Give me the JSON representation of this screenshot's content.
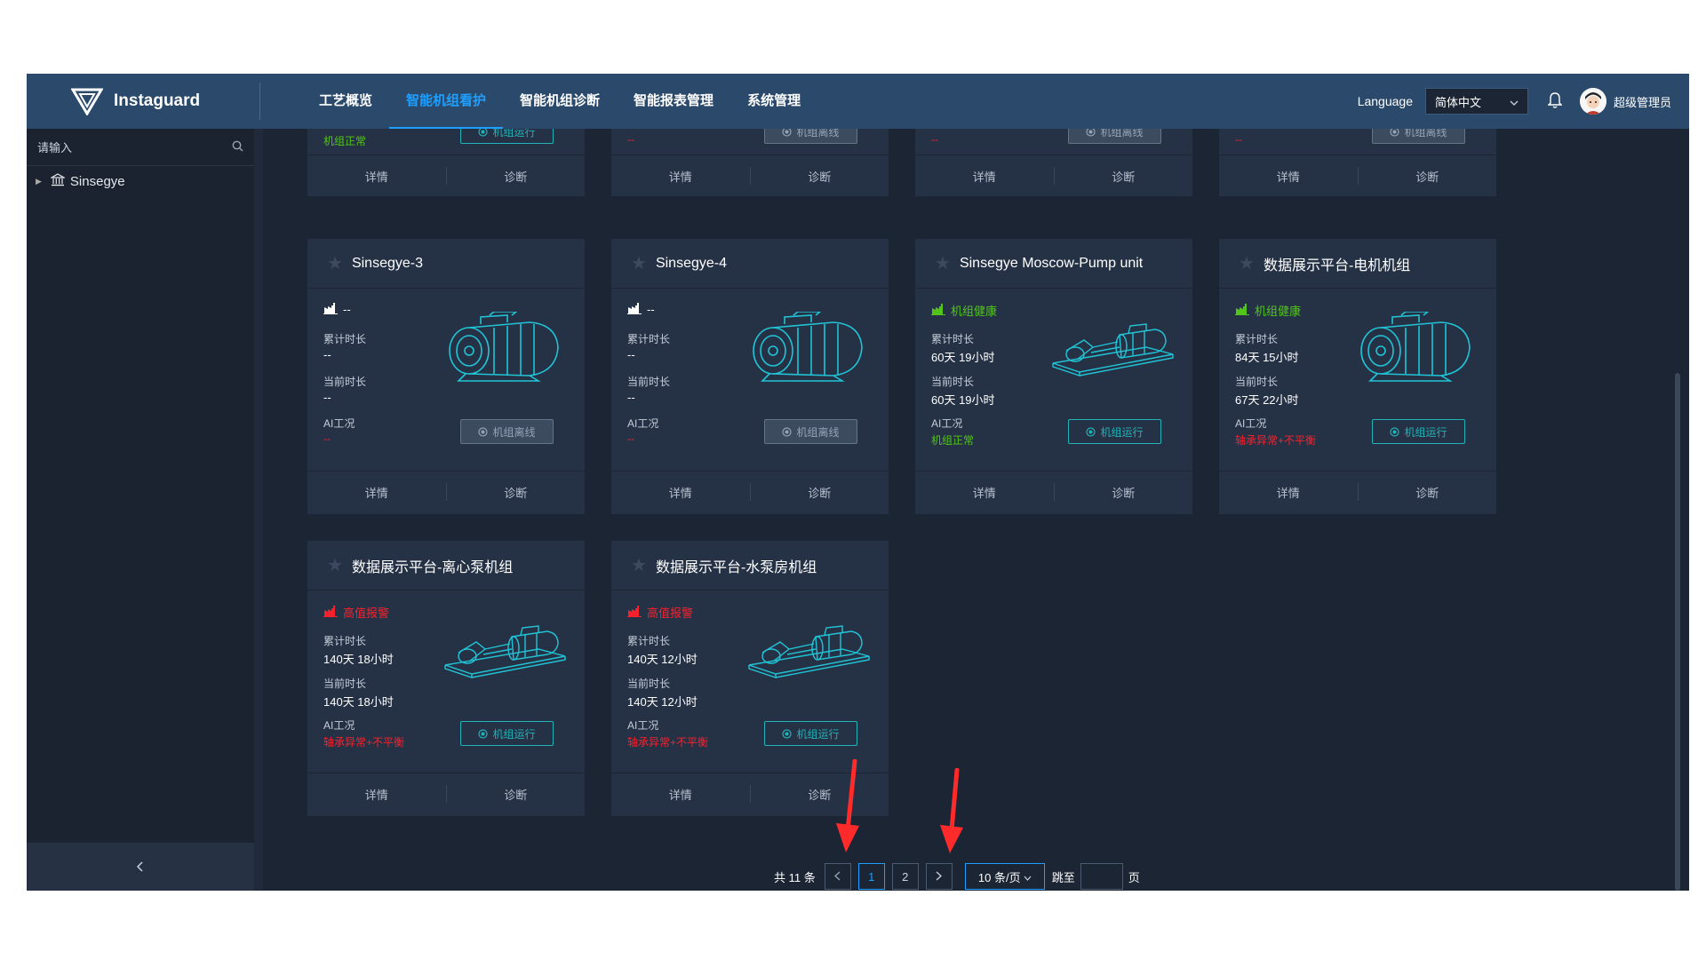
{
  "header": {
    "brand": "Instaguard",
    "nav": [
      {
        "label": "工艺概览",
        "active": false
      },
      {
        "label": "智能机组看护",
        "active": true
      },
      {
        "label": "智能机组诊断",
        "active": false
      },
      {
        "label": "智能报表管理",
        "active": false
      },
      {
        "label": "系统管理",
        "active": false
      }
    ],
    "language_label": "Language",
    "language_value": "简体中文",
    "username": "超级管理员"
  },
  "sidebar": {
    "search_placeholder": "请输入",
    "tree_root": "Sinsegye"
  },
  "labels": {
    "accum": "累计时长",
    "current": "当前时长",
    "ai": "AI工况",
    "detail": "详情",
    "diagnose": "诊断"
  },
  "top_partial_cards": [
    {
      "ai_status": "机组正常",
      "ai_color": "green",
      "button": "机组运行",
      "button_state": "online"
    },
    {
      "ai_status": "--",
      "ai_color": "red",
      "button": "机组离线",
      "button_state": "offline"
    },
    {
      "ai_status": "--",
      "ai_color": "red",
      "button": "机组离线",
      "button_state": "offline"
    },
    {
      "ai_status": "--",
      "ai_color": "red",
      "button": "机组离线",
      "button_state": "offline"
    }
  ],
  "cards": [
    {
      "title": "Sinsegye-3",
      "health": "--",
      "health_color": "white",
      "accum": "--",
      "current": "--",
      "ai_status": "--",
      "ai_color": "red",
      "button": "机组离线",
      "button_state": "offline",
      "machine": "motor"
    },
    {
      "title": "Sinsegye-4",
      "health": "--",
      "health_color": "white",
      "accum": "--",
      "current": "--",
      "ai_status": "--",
      "ai_color": "red",
      "button": "机组离线",
      "button_state": "offline",
      "machine": "motor"
    },
    {
      "title": "Sinsegye Moscow-Pump unit",
      "health": "机组健康",
      "health_color": "green",
      "accum": "60天 19小时",
      "current": "60天 19小时",
      "ai_status": "机组正常",
      "ai_color": "green",
      "button": "机组运行",
      "button_state": "online",
      "machine": "pump"
    },
    {
      "title": "数据展示平台-电机机组",
      "health": "机组健康",
      "health_color": "green",
      "accum": "84天 15小时",
      "current": "67天 22小时",
      "ai_status": "轴承异常+不平衡",
      "ai_color": "red",
      "button": "机组运行",
      "button_state": "online",
      "machine": "motor"
    },
    {
      "title": "数据展示平台-离心泵机组",
      "health": "高值报警",
      "health_color": "red",
      "accum": "140天 18小时",
      "current": "140天 18小时",
      "ai_status": "轴承异常+不平衡",
      "ai_color": "red",
      "button": "机组运行",
      "button_state": "online",
      "machine": "pump"
    },
    {
      "title": "数据展示平台-水泵房机组",
      "health": "高值报警",
      "health_color": "red",
      "accum": "140天 12小时",
      "current": "140天 12小时",
      "ai_status": "轴承异常+不平衡",
      "ai_color": "red",
      "button": "机组运行",
      "button_state": "online",
      "machine": "pump"
    }
  ],
  "pagination": {
    "total": "共 11 条",
    "pages": [
      "1",
      "2"
    ],
    "current_page": "1",
    "page_size": "10 条/页",
    "goto_label": "跳至",
    "goto_suffix": "页"
  },
  "colors": {
    "header_bg": "#2b4a6b",
    "accent": "#1e9fff",
    "health_green": "#52c41a",
    "alarm_red": "#f5222d",
    "run_teal": "#21b3b8",
    "annotation_red": "#ff2a2a"
  }
}
